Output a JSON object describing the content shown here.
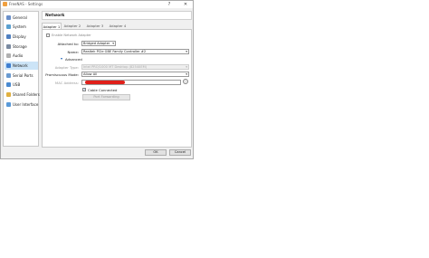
{
  "window": {
    "title": "FreeNAS - Settings",
    "help_symbol": "?",
    "close_symbol": "✕"
  },
  "sidebar": {
    "items": [
      {
        "label": "General",
        "icon": "general-icon",
        "color": "#6a8fc9"
      },
      {
        "label": "System",
        "icon": "system-icon",
        "color": "#5aa0d0"
      },
      {
        "label": "Display",
        "icon": "display-icon",
        "color": "#4f7fc0"
      },
      {
        "label": "Storage",
        "icon": "storage-icon",
        "color": "#7a8aa0"
      },
      {
        "label": "Audio",
        "icon": "audio-icon",
        "color": "#b0b0b0"
      },
      {
        "label": "Network",
        "icon": "network-icon",
        "color": "#3e7ed0",
        "selected": true
      },
      {
        "label": "Serial Ports",
        "icon": "serial-ports-icon",
        "color": "#6a9ad0"
      },
      {
        "label": "USB",
        "icon": "usb-icon",
        "color": "#4a8ad0"
      },
      {
        "label": "Shared Folders",
        "icon": "shared-folders-icon",
        "color": "#e0b040"
      },
      {
        "label": "User Interface",
        "icon": "user-interface-icon",
        "color": "#5a9ad8"
      }
    ]
  },
  "header": {
    "title": "Network"
  },
  "tabs": [
    "Adapter 1",
    "Adapter 2",
    "Adapter 3",
    "Adapter 4"
  ],
  "adapter": {
    "enable_label": "Enable Network Adapter",
    "attached_label": "Attached to:",
    "attached_value": "Bridged Adapter",
    "name_label": "Name:",
    "name_value": "Realtek PCIe GBE Family Controller #2",
    "advanced_label": "Advanced",
    "adapter_type_label": "Adapter Type:",
    "adapter_type_value": "Intel PRO/1000 MT Desktop (82540EM)",
    "promiscuous_label": "Promiscuous Mode:",
    "promiscuous_value": "Allow All",
    "mac_label": "MAC Address:",
    "cable_label": "Cable Connected",
    "port_forwarding_label": "Port Forwarding"
  },
  "footer": {
    "ok_label": "OK",
    "cancel_label": "Cancel"
  }
}
